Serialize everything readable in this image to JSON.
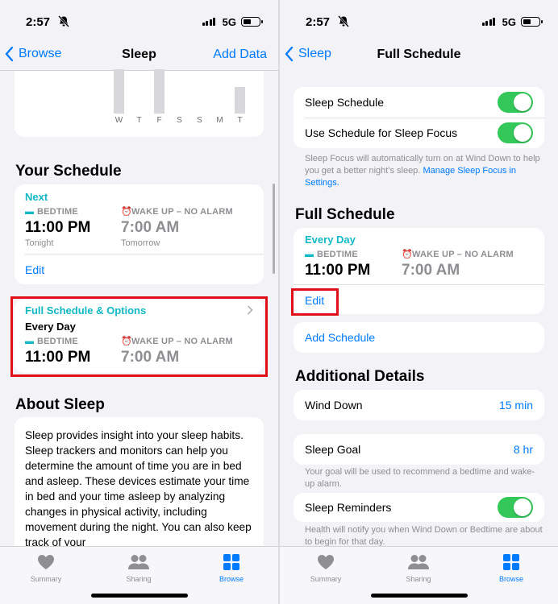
{
  "status": {
    "time": "2:57",
    "network": "5G"
  },
  "left": {
    "nav": {
      "back": "Browse",
      "title": "Sleep",
      "action": "Add Data"
    },
    "chart": {
      "days": [
        "W",
        "T",
        "F",
        "S",
        "S",
        "M",
        "T"
      ],
      "bar_levels": [
        1.0,
        0,
        1.0,
        0,
        0,
        0,
        0.6
      ]
    },
    "schedule_title": "Your Schedule",
    "next_card": {
      "heading": "Next",
      "bedtime_label": "BEDTIME",
      "bedtime": "11:00 PM",
      "bedtime_sub": "Tonight",
      "wake_label": "WAKE UP – NO ALARM",
      "wake": "7:00 AM",
      "wake_sub": "Tomorrow",
      "edit": "Edit"
    },
    "full_card": {
      "heading": "Full Schedule & Options",
      "days": "Every Day",
      "bedtime_label": "BEDTIME",
      "bedtime": "11:00 PM",
      "wake_label": "WAKE UP – NO ALARM",
      "wake": "7:00 AM"
    },
    "about_title": "About Sleep",
    "about_text": "Sleep provides insight into your sleep habits. Sleep trackers and monitors can help you determine the amount of time you are in bed and asleep. These devices estimate your time in bed and your time asleep by analyzing changes in physical activity, including movement during the night. You can also keep track of your"
  },
  "right": {
    "nav": {
      "back": "Sleep",
      "title": "Full Schedule"
    },
    "sleep_schedule": "Sleep Schedule",
    "use_schedule": "Use Schedule for Sleep Focus",
    "focus_note": "Sleep Focus will automatically turn on at Wind Down to help you get a better night's sleep.",
    "focus_link": "Manage Sleep Focus in Settings.",
    "full_schedule_title": "Full Schedule",
    "card": {
      "days": "Every Day",
      "bedtime_label": "BEDTIME",
      "bedtime": "11:00 PM",
      "wake_label": "WAKE UP – NO ALARM",
      "wake": "7:00 AM",
      "edit": "Edit"
    },
    "add_schedule": "Add Schedule",
    "additional_title": "Additional Details",
    "wind_down": {
      "label": "Wind Down",
      "value": "15 min"
    },
    "sleep_goal": {
      "label": "Sleep Goal",
      "value": "8 hr"
    },
    "goal_note": "Your goal will be used to recommend a bedtime and wake-up alarm.",
    "reminders": "Sleep Reminders",
    "reminders_note": "Health will notify you when Wind Down or Bedtime are about to begin for that day."
  },
  "tabs": [
    {
      "label": "Summary",
      "icon": "heart-icon"
    },
    {
      "label": "Sharing",
      "icon": "people-icon"
    },
    {
      "label": "Browse",
      "icon": "grid-icon"
    }
  ],
  "colors": {
    "accent": "#007aff",
    "teal": "#12b8c4",
    "toggle": "#34c759",
    "highlight": "#e0101a"
  }
}
